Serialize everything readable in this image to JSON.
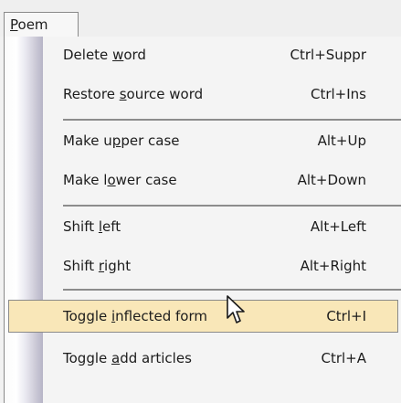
{
  "menu": {
    "title": "Poem",
    "items": [
      {
        "pre": "Delete ",
        "ul": "w",
        "post": "ord",
        "shortcut": "Ctrl+Suppr"
      },
      {
        "pre": "Restore ",
        "ul": "s",
        "post": "ource word",
        "shortcut": "Ctrl+Ins"
      },
      {
        "pre": "Make u",
        "ul": "p",
        "post": "per case",
        "shortcut": "Alt+Up"
      },
      {
        "pre": "Make l",
        "ul": "o",
        "post": "wer case",
        "shortcut": "Alt+Down"
      },
      {
        "pre": "Shift ",
        "ul": "l",
        "post": "eft",
        "shortcut": "Alt+Left"
      },
      {
        "pre": "Shift ",
        "ul": "r",
        "post": "ight",
        "shortcut": "Alt+Right"
      },
      {
        "pre": "Toggle ",
        "ul": "i",
        "post": "nflected form",
        "shortcut": "Ctrl+I"
      },
      {
        "pre": "Toggle ",
        "ul": "a",
        "post": "dd articles",
        "shortcut": "Ctrl+A"
      }
    ],
    "highlighted_item": "Toggle inflected form"
  },
  "colors": {
    "highlight": "#f9e7b8",
    "menu_background": "#f4f4f4",
    "border": "#8a8a8a"
  },
  "icons": {
    "cursor": "arrow-pointer-icon"
  }
}
